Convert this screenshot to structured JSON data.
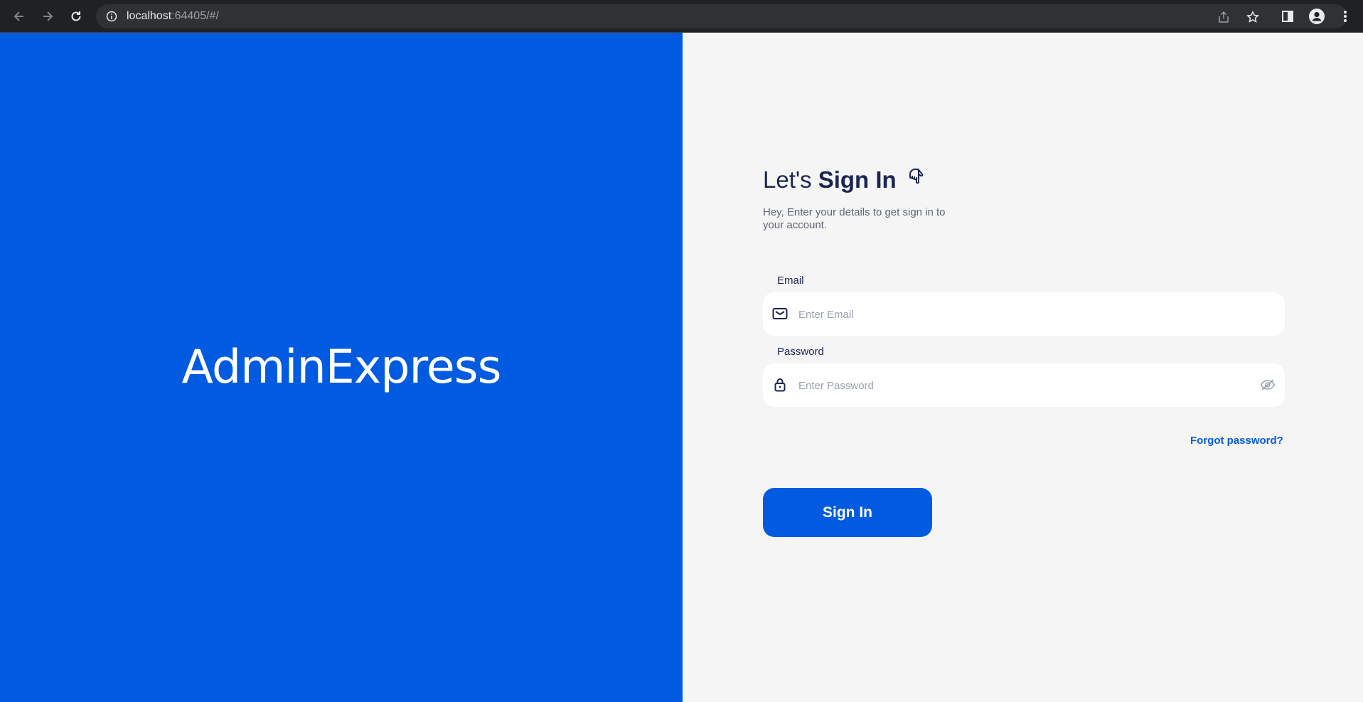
{
  "browser": {
    "url_host": "localhost",
    "url_rest": ":64405/#/"
  },
  "brand": {
    "name": "AdminExpress",
    "panel_color": "#015be0"
  },
  "form": {
    "heading_light": "Let's",
    "heading_bold": "Sign In",
    "heading_icon": "pointing-hand-icon",
    "subtitle": "Hey, Enter your details to get sign in to your account.",
    "email": {
      "label": "Email",
      "placeholder": "Enter Email",
      "icon": "mail-icon"
    },
    "password": {
      "label": "Password",
      "placeholder": "Enter Password",
      "icon": "lock-icon",
      "toggle_icon": "eye-off-icon"
    },
    "forgot_label": "Forgot password?",
    "submit_label": "Sign In",
    "accent": "#015be0",
    "text_color": "#1c2454"
  }
}
